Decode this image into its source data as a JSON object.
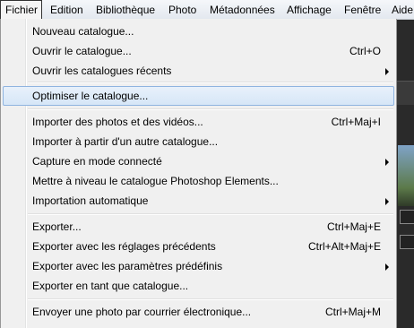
{
  "menubar": {
    "items": [
      {
        "label": "Fichier"
      },
      {
        "label": "Edition"
      },
      {
        "label": "Bibliothèque"
      },
      {
        "label": "Photo"
      },
      {
        "label": "Métadonnées"
      },
      {
        "label": "Affichage"
      },
      {
        "label": "Fenêtre"
      },
      {
        "label": "Aide"
      }
    ],
    "active": "Fichier"
  },
  "menu": {
    "items": [
      {
        "label": "Nouveau catalogue...",
        "shortcut": ""
      },
      {
        "label": "Ouvrir le catalogue...",
        "shortcut": "Ctrl+O"
      },
      {
        "label": "Ouvrir les catalogues récents",
        "shortcut": "",
        "submenu": true
      },
      {
        "label": "Optimiser le catalogue...",
        "shortcut": "",
        "highlighted": true
      },
      {
        "label": "Importer des photos et des vidéos...",
        "shortcut": "Ctrl+Maj+I"
      },
      {
        "label": "Importer à partir d'un autre catalogue...",
        "shortcut": ""
      },
      {
        "label": "Capture en mode connecté",
        "shortcut": "",
        "submenu": true
      },
      {
        "label": "Mettre à niveau le catalogue Photoshop Elements...",
        "shortcut": ""
      },
      {
        "label": "Importation automatique",
        "shortcut": "",
        "submenu": true
      },
      {
        "label": "Exporter...",
        "shortcut": "Ctrl+Maj+E"
      },
      {
        "label": "Exporter avec les réglages précédents",
        "shortcut": "Ctrl+Alt+Maj+E"
      },
      {
        "label": "Exporter avec les paramètres prédéfinis",
        "shortcut": "",
        "submenu": true
      },
      {
        "label": "Exporter en tant que catalogue...",
        "shortcut": ""
      },
      {
        "label": "Envoyer une photo par courrier électronique...",
        "shortcut": "Ctrl+Maj+M"
      }
    ]
  },
  "colors": {
    "highlight_border": "#8fb4e0",
    "menu_background": "#f0f0f0"
  }
}
